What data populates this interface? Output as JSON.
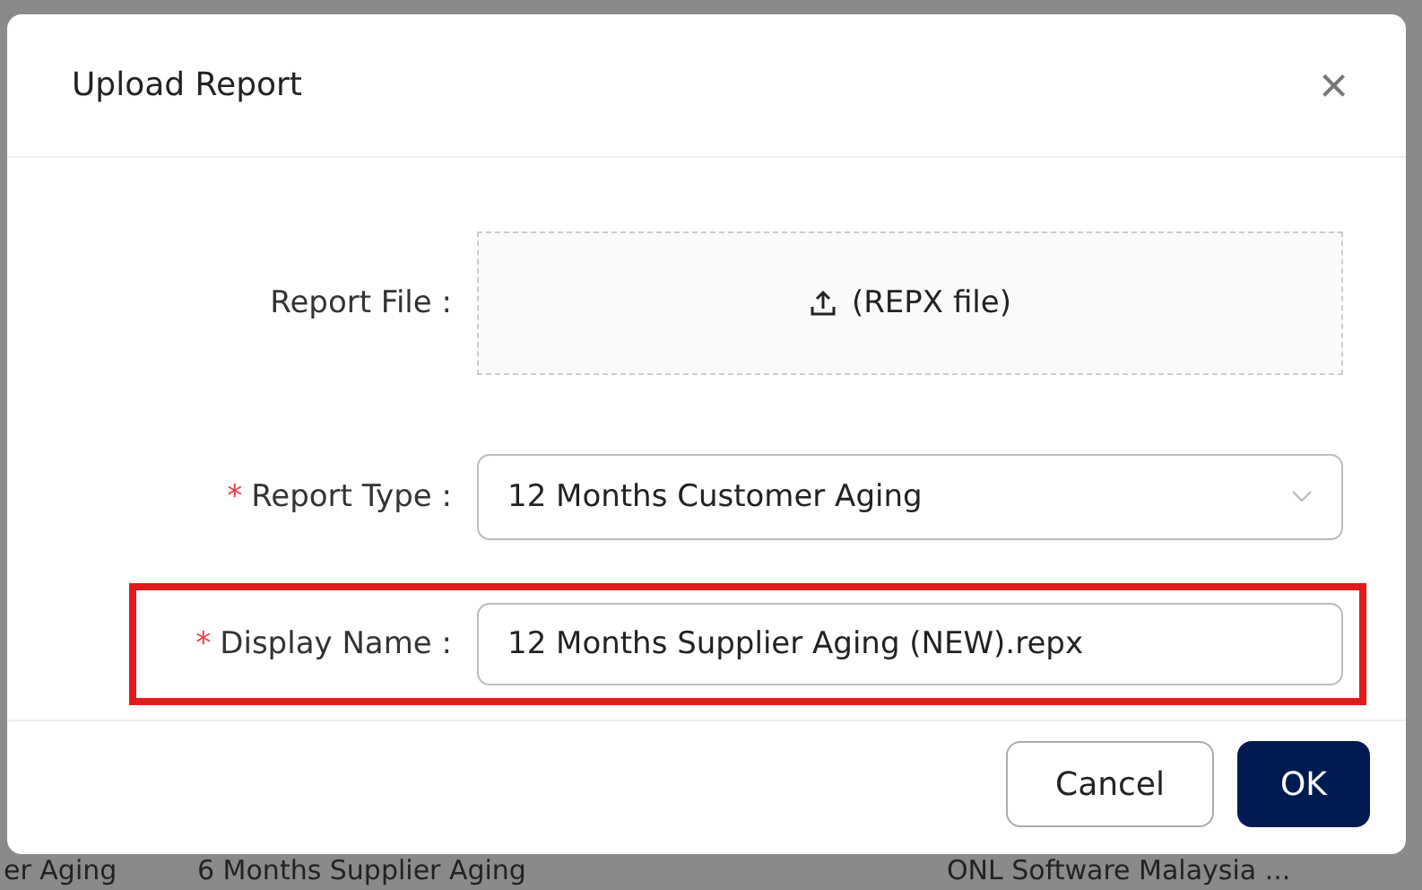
{
  "background_row": [
    "er Aging",
    "6 Months Supplier Aging",
    "ONL Software Malaysia ..."
  ],
  "dialog": {
    "title": "Upload Report",
    "close": "×",
    "required_mark": "*",
    "fields": [
      {
        "kind": "upload",
        "label": "Report File :",
        "required": false,
        "highlighted": false,
        "icon_text": "(REPX file)"
      },
      {
        "kind": "select",
        "label": "Report Type :",
        "required": true,
        "highlighted": false,
        "value": "12 Months Customer Aging"
      },
      {
        "kind": "text",
        "label": "Display Name :",
        "required": true,
        "highlighted": true,
        "value": "12 Months Supplier Aging (NEW).repx"
      }
    ],
    "buttons": [
      {
        "label": "Cancel",
        "kind": "secondary"
      },
      {
        "label": "OK",
        "kind": "primary"
      }
    ]
  }
}
